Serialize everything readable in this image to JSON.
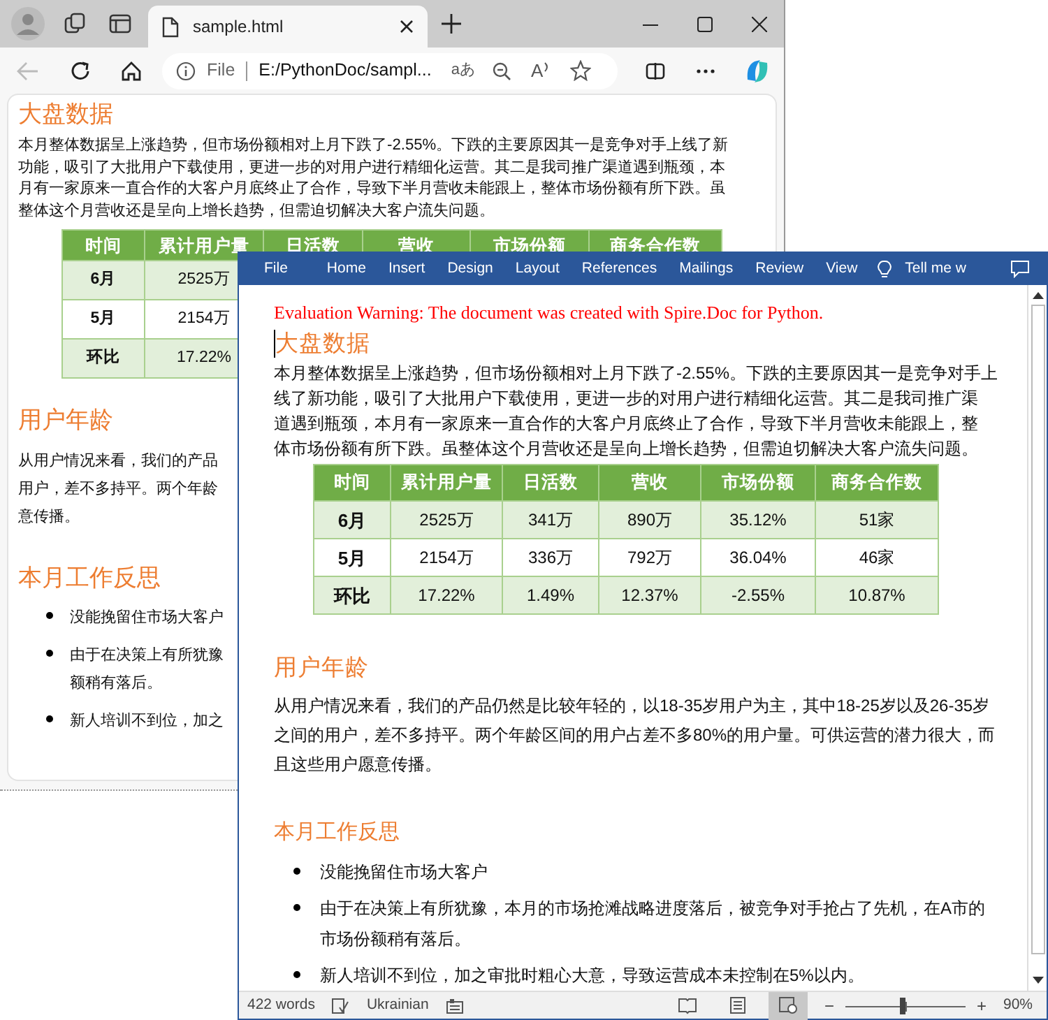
{
  "browser": {
    "tabs": [
      {
        "title": "sample.html",
        "selected": true
      }
    ],
    "back": {
      "disabled": true
    },
    "address": {
      "scheme": "File",
      "url": "E:/PythonDoc/sampl...",
      "translate": "aあ",
      "read_aloud": "A"
    },
    "sections": [
      {
        "heading": "大盘数据",
        "paragraph": [
          "本月整体数据呈上涨趋势，但市场份额相对上月下跌了-2.55%。下跌的主要原因其一是竞争对手上线了新",
          "功能，吸引了大批用户下载使用，更进一步的对用户进行精细化运营。其二是我司推广渠道遇到瓶颈，本",
          "月有一家原来一直合作的大客户月底终止了合作，导致下半月营收未能跟上，整体市场份额有所下跌。虽",
          "整体这个月营收还是呈向上增长趋势，但需迫切解决大客户流失问题。"
        ],
        "table": {
          "columns": [
            "时间",
            "累计用户量",
            "日活数",
            "营收",
            "市场份额",
            "商务合作数"
          ],
          "rows": [
            [
              "6月",
              "2525万"
            ],
            [
              "5月",
              "2154万"
            ],
            [
              "环比",
              "17.22%"
            ]
          ]
        }
      },
      {
        "heading": "用户年龄",
        "paragraph": [
          "从用户情况来看，我们的产品",
          "用户，差不多持平。两个年龄",
          "意传播。"
        ]
      },
      {
        "heading": "本月工作反思",
        "bullets": [
          [
            "没能挽留住市场大客户"
          ],
          [
            "由于在决策上有所犹豫",
            "额稍有落后。"
          ],
          [
            "新人培训不到位，加之"
          ]
        ]
      }
    ]
  },
  "word": {
    "menu": [
      "File",
      "Home",
      "Insert",
      "Design",
      "Layout",
      "References",
      "Mailings",
      "Review",
      "View"
    ],
    "tell_me": "Tell me w",
    "warning": "Evaluation Warning: The document was created with Spire.Doc for Python.",
    "sections": [
      {
        "heading": "大盘数据",
        "paragraph": [
          "本月整体数据呈上涨趋势，但市场份额相对上月下跌了-2.55%。下跌的主要原因其一是竞争对手上",
          "线了新功能，吸引了大批用户下载使用，更进一步的对用户进行精细化运营。其二是我司推广渠",
          "道遇到瓶颈，本月有一家原来一直合作的大客户月底终止了合作，导致下半月营收未能跟上，整",
          "体市场份额有所下跌。虽整体这个月营收还是呈向上增长趋势，但需迫切解决大客户流失问题。"
        ],
        "table": {
          "columns": [
            "时间",
            "累计用户量",
            "日活数",
            "营收",
            "市场份额",
            "商务合作数"
          ],
          "rows": [
            [
              "6月",
              "2525万",
              "341万",
              "890万",
              "35.12%",
              "51家"
            ],
            [
              "5月",
              "2154万",
              "336万",
              "792万",
              "36.04%",
              "46家"
            ],
            [
              "环比",
              "17.22%",
              "1.49%",
              "12.37%",
              "-2.55%",
              "10.87%"
            ]
          ]
        }
      },
      {
        "heading": "用户年龄",
        "paragraph": [
          "从用户情况来看，我们的产品仍然是比较年轻的，以18-35岁用户为主，其中18-25岁以及26-35岁",
          "之间的用户，差不多持平。两个年龄区间的用户占差不多80%的用户量。可供运营的潜力很大，而",
          "且这些用户愿意传播。"
        ]
      },
      {
        "heading": "本月工作反思",
        "bullets": [
          [
            "没能挽留住市场大客户"
          ],
          [
            "由于在决策上有所犹豫，本月的市场抢滩战略进度落后，被竞争对手抢占了先机，在A市的",
            "市场份额稍有落后。"
          ],
          [
            "新人培训不到位，加之审批时粗心大意，导致运营成本未控制在5%以内。"
          ]
        ]
      }
    ],
    "status_bar": {
      "words": "422 words",
      "language": "Ukrainian",
      "views": [
        {
          "kind": "read",
          "selected": false
        },
        {
          "kind": "print",
          "selected": false
        },
        {
          "kind": "web",
          "selected": true
        }
      ],
      "zoom_out": "−",
      "zoom_in": "+",
      "zoom": {
        "level": 0.48
      },
      "zoom_label": "90%"
    }
  }
}
